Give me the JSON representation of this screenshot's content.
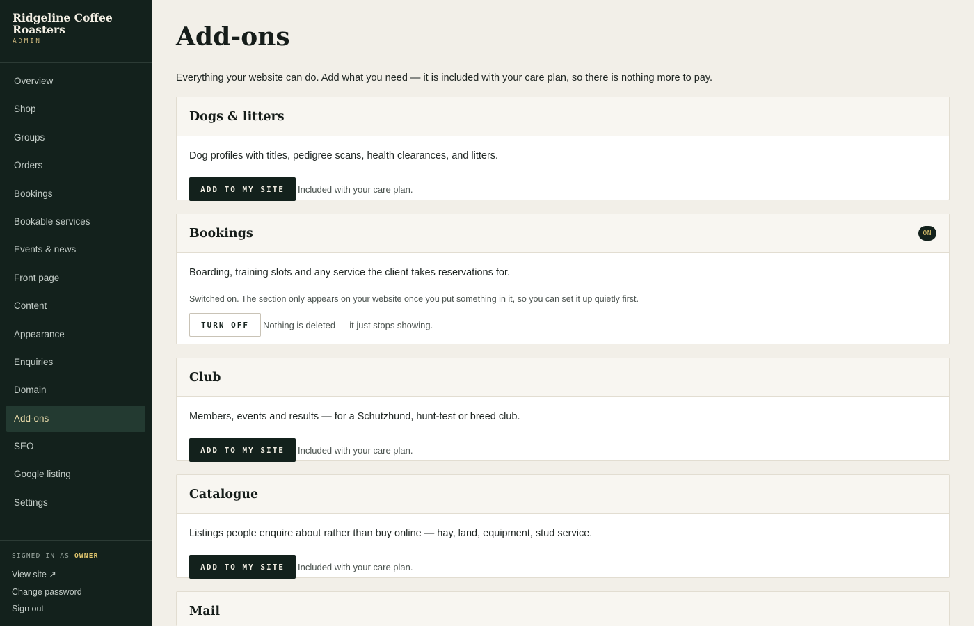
{
  "sidebar": {
    "brand_name": "Ridgeline Coffee Roasters",
    "brand_sub": "ADMIN",
    "nav": [
      {
        "label": "Overview"
      },
      {
        "label": "Shop"
      },
      {
        "label": "Groups"
      },
      {
        "label": "Orders"
      },
      {
        "label": "Bookings"
      },
      {
        "label": "Bookable services"
      },
      {
        "label": "Events & news"
      },
      {
        "label": "Front page"
      },
      {
        "label": "Content"
      },
      {
        "label": "Appearance"
      },
      {
        "label": "Enquiries"
      },
      {
        "label": "Domain"
      },
      {
        "label": "Add-ons",
        "active": true
      },
      {
        "label": "SEO"
      },
      {
        "label": "Google listing"
      },
      {
        "label": "Settings"
      }
    ],
    "footer": {
      "signed_in_as": "SIGNED IN AS",
      "role": "OWNER",
      "view_site": "View site ↗",
      "change_password": "Change password",
      "sign_out": "Sign out"
    }
  },
  "main": {
    "title": "Add-ons",
    "intro": "Everything your website can do. Add what you need — it is included with your care plan, so there is nothing more to pay.",
    "cards": [
      {
        "title": "Dogs & litters",
        "description": "Dog profiles with titles, pedigree scans, health clearances, and litters.",
        "button": "ADD TO MY SITE",
        "hint": "Included with your care plan."
      },
      {
        "title": "Bookings",
        "badge": "ON",
        "description": "Boarding, training slots and any service the client takes reservations for.",
        "note": "Switched on. The section only appears on your website once you put something in it, so you can set it up quietly first.",
        "button": "TURN OFF",
        "hint": "Nothing is deleted — it just stops showing."
      },
      {
        "title": "Club",
        "description": "Members, events and results — for a Schutzhund, hunt-test or breed club.",
        "button": "ADD TO MY SITE",
        "hint": "Included with your care plan."
      },
      {
        "title": "Catalogue",
        "description": "Listings people enquire about rather than buy online — hay, land, equipment, stud service.",
        "button": "ADD TO MY SITE",
        "hint": "Included with your care plan."
      },
      {
        "title": "Mail"
      }
    ]
  }
}
